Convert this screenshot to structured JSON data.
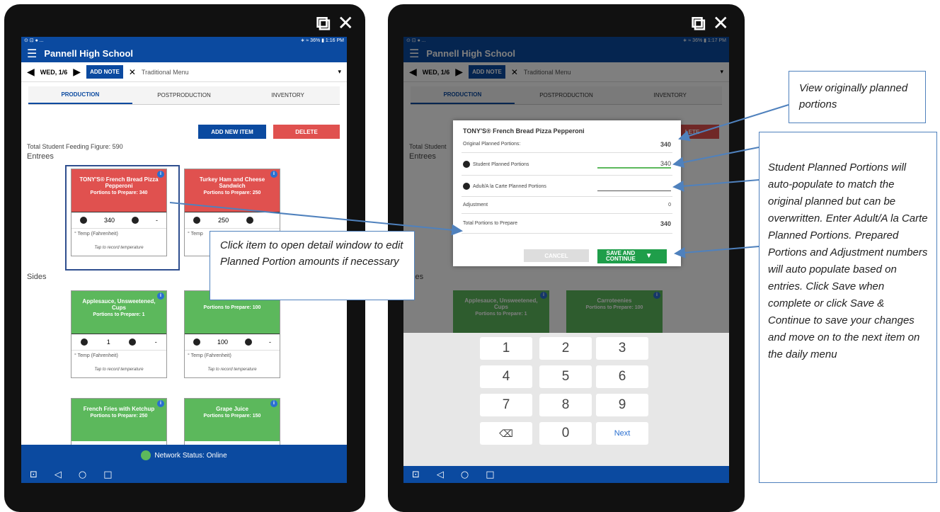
{
  "left": {
    "status_left": "⊙ ⊡ ● ...",
    "status_right": "∗ ≈ 36% ▮ 1:16 PM",
    "school": "Pannell High School",
    "date": "WED, 1/6",
    "add_note": "ADD NOTE",
    "menu": "Traditional Menu",
    "tabs": [
      "PRODUCTION",
      "POSTPRODUCTION",
      "INVENTORY"
    ],
    "add_new": "ADD NEW ITEM",
    "delete": "DELETE",
    "feeding": "Total Student Feeding Figure: 590",
    "entrees": "Entrees",
    "sides": "Sides",
    "cards": [
      {
        "name": "TONY'S® French Bread Pizza Pepperoni",
        "prep": "Portions to Prepare: 340",
        "count": "340",
        "dash": "-",
        "temp": "° Temp (Fahrenheit)",
        "tap": "Tap to record temperature"
      },
      {
        "name": "Turkey Ham and Cheese Sandwich",
        "prep": "Portions to Prepare: 250",
        "count": "250",
        "temp": "° Temp"
      },
      {
        "name": "Applesauce, Unsweetened, Cups",
        "prep": "Portions to Prepare: 1",
        "count": "1",
        "dash": "-",
        "temp": "° Temp (Fahrenheit)",
        "tap": "Tap to record temperature"
      },
      {
        "prep": "Portions to Prepare: 100",
        "count": "100",
        "dash": "-",
        "temp": "° Temp (Fahrenheit)",
        "tap": "Tap to record temperature"
      },
      {
        "name": "French Fries with Ketchup",
        "prep": "Portions to Prepare: 250"
      },
      {
        "name": "Grape Juice",
        "prep": "Portions to Prepare: 150"
      }
    ],
    "network": "Network Status: Online"
  },
  "right": {
    "status_right": "∗ ≈ 36% ▮ 1:17 PM",
    "school": "Pannell High School",
    "date": "WED, 1/6",
    "add_note": "ADD NOTE",
    "menu": "Traditional Menu",
    "tabs": [
      "PRODUCTION",
      "POSTPRODUCTION",
      "INVENTORY"
    ],
    "delete_partial": "LETE",
    "feeding_partial": "Total Student",
    "entrees": "Entrees",
    "sides_partial": "ides",
    "dialog": {
      "title": "TONY'S® French Bread Pizza Pepperoni",
      "rows": [
        {
          "label": "Original Planned Portions:",
          "value": "340"
        },
        {
          "label": "Student Planned Portions",
          "value": "340"
        },
        {
          "label": "Adult/A la Carte Planned Portions",
          "value": ""
        },
        {
          "label": "Adjustment",
          "value": "0"
        },
        {
          "label": "Total Portions to Prepare",
          "value": "340"
        }
      ],
      "cancel": "CANCEL",
      "save1": "SAVE AND",
      "save2": "CONTINUE"
    },
    "bg_cards": [
      {
        "name": "Applesauce, Unsweetened, Cups",
        "prep": "Portions to Prepare: 1"
      },
      {
        "name": "Carroteenies",
        "prep": "Portions to Prepare: 100"
      }
    ],
    "keys": [
      "1",
      "2",
      "3",
      "4",
      "5",
      "6",
      "7",
      "8",
      "9",
      "⌫",
      "0",
      "Next"
    ]
  },
  "callouts": {
    "click_item": "Click item to open detail window to edit Planned Portion amounts if necessary",
    "view_original": "View originally planned portions",
    "student_planned": "Student Planned Portions will auto-populate to match the original planned but can be overwritten. Enter Adult/A la Carte Planned Portions. Prepared Portions and Adjustment numbers will auto populate based on entries. Click Save when complete or click Save & Continue to save your changes and move on to the next item on the daily menu"
  },
  "window_icons": "⧉ ✕",
  "colors": {
    "blue": "#0b4aa0",
    "red": "#e0514f",
    "green": "#5cb85c"
  }
}
